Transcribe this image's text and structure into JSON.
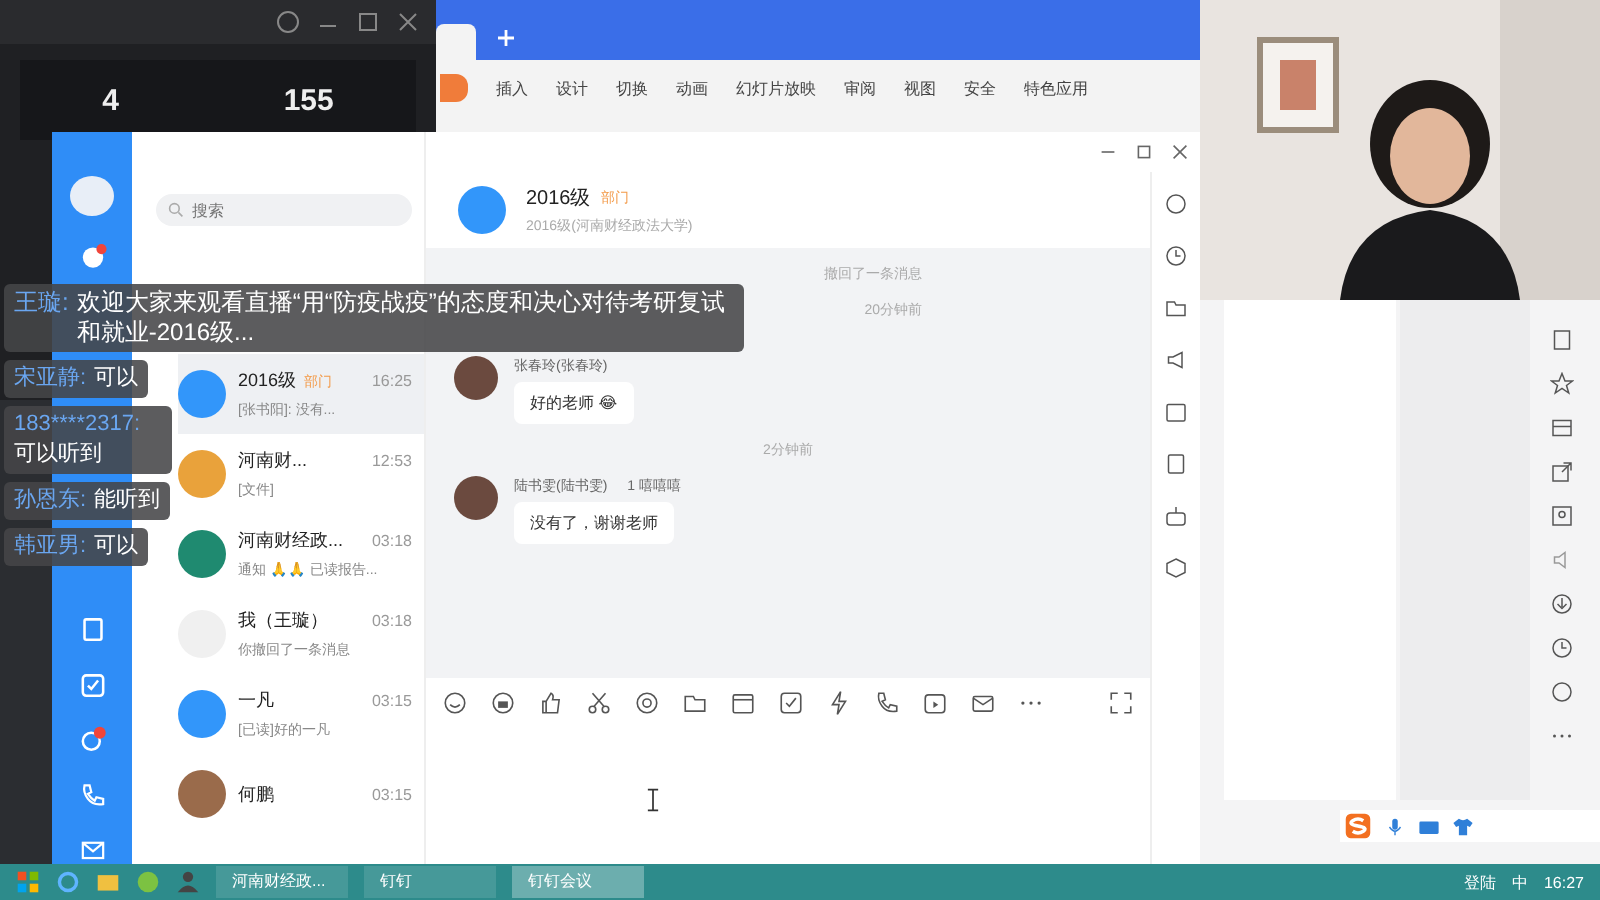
{
  "dark_window": {
    "stats": [
      "4",
      "155"
    ]
  },
  "wps": {
    "ribbon": [
      {
        "label": "插入"
      },
      {
        "label": "设计"
      },
      {
        "label": "切换"
      },
      {
        "label": "动画"
      },
      {
        "label": "幻灯片放映"
      },
      {
        "label": "审阅"
      },
      {
        "label": "视图"
      },
      {
        "label": "安全"
      },
      {
        "label": "特色应用"
      }
    ]
  },
  "chat_app": {
    "search": {
      "placeholder": "搜索"
    },
    "conversations": [
      {
        "name": "2016级",
        "tag": "部门",
        "time": "16:25",
        "preview": "[张书阳]: 没有...",
        "selected": true
      },
      {
        "name": "河南财...",
        "time": "12:53",
        "preview": "[文件]",
        "selected": false
      },
      {
        "name": "河南财经政...",
        "time": "03:18",
        "preview": "通知 🙏🙏 已读报告...",
        "selected": false
      },
      {
        "name": "我（王璇）",
        "time": "03:18",
        "preview": "你撤回了一条消息",
        "selected": false
      },
      {
        "name": "一凡",
        "time": "03:15",
        "preview": "[已读]好的一凡",
        "selected": false
      },
      {
        "name": "何鹏",
        "time": "03:15",
        "selected": false
      }
    ],
    "chat": {
      "title": "2016级",
      "tag": "部门",
      "subtitle": "2016级(河南财经政法大学)",
      "messages": [
        {
          "kind": "notice",
          "text": "撤回了一条消息"
        },
        {
          "kind": "time",
          "text": "20分钟前"
        },
        {
          "kind": "message",
          "sender": "张春玲(张春玲)",
          "text": "好的老师 😂"
        },
        {
          "kind": "time",
          "text": "2分钟前"
        },
        {
          "kind": "message",
          "sender": "陆书雯(陆书雯)",
          "note": "1 嘻嘻嘻",
          "text": "没有了，谢谢老师"
        }
      ]
    }
  },
  "comments": [
    {
      "name": "王璇:",
      "text": "欢迎大家来观看直播“用“防疫战疫”的态度和决心对待考研复试和就业-2016级..."
    },
    {
      "name": "宋亚静:",
      "text": "可以"
    },
    {
      "name": "183****2317:",
      "text": "可以听到"
    },
    {
      "name": "孙恩东:",
      "text": "能听到"
    },
    {
      "name": "韩亚男:",
      "text": "可以"
    }
  ],
  "taskbar": {
    "apps": [
      {
        "label": "河南财经政...",
        "selected": false
      },
      {
        "label": "钉钉",
        "selected": false
      },
      {
        "label": "钉钉会议",
        "selected": true
      }
    ],
    "tray": [
      "登陆",
      "中",
      "16:27"
    ]
  }
}
